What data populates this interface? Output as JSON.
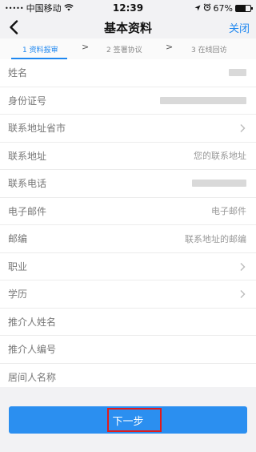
{
  "status_bar": {
    "signal": "•••••",
    "carrier": "中国移动",
    "wifi_icon": "wifi-icon",
    "time": "12:39",
    "location_icon": "location-arrow-icon",
    "alarm_icon": "alarm-icon",
    "battery_percent": "67%",
    "battery_level": 0.67
  },
  "nav": {
    "back_icon": "chevron-left-icon",
    "title": "基本资料",
    "close_label": "关闭"
  },
  "steps": [
    {
      "label": "1 资料报审",
      "active": true
    },
    {
      "label": "2 签署协议",
      "active": false
    },
    {
      "label": "3 在线回访",
      "active": false
    }
  ],
  "step_separator": ">",
  "form": {
    "rows": [
      {
        "label": "姓名",
        "value": ""
      },
      {
        "label": "身份证号",
        "value": ""
      },
      {
        "label": "联系地址省市",
        "value": ""
      },
      {
        "label": "联系地址",
        "value": "您的联系地址"
      },
      {
        "label": "联系电话",
        "value": ""
      },
      {
        "label": "电子邮件",
        "value": "电子邮件"
      },
      {
        "label": "邮编",
        "value": "联系地址的邮编"
      },
      {
        "label": "职业",
        "value": ""
      },
      {
        "label": "学历",
        "value": ""
      },
      {
        "label": "推介人姓名",
        "value": ""
      },
      {
        "label": "推介人编号",
        "value": ""
      },
      {
        "label": "居间人名称",
        "value": ""
      }
    ]
  },
  "next_button": {
    "label": "下一步"
  },
  "colors": {
    "accent": "#1e87f0",
    "button": "#2b8ff0",
    "highlight": "#e11b1b"
  }
}
